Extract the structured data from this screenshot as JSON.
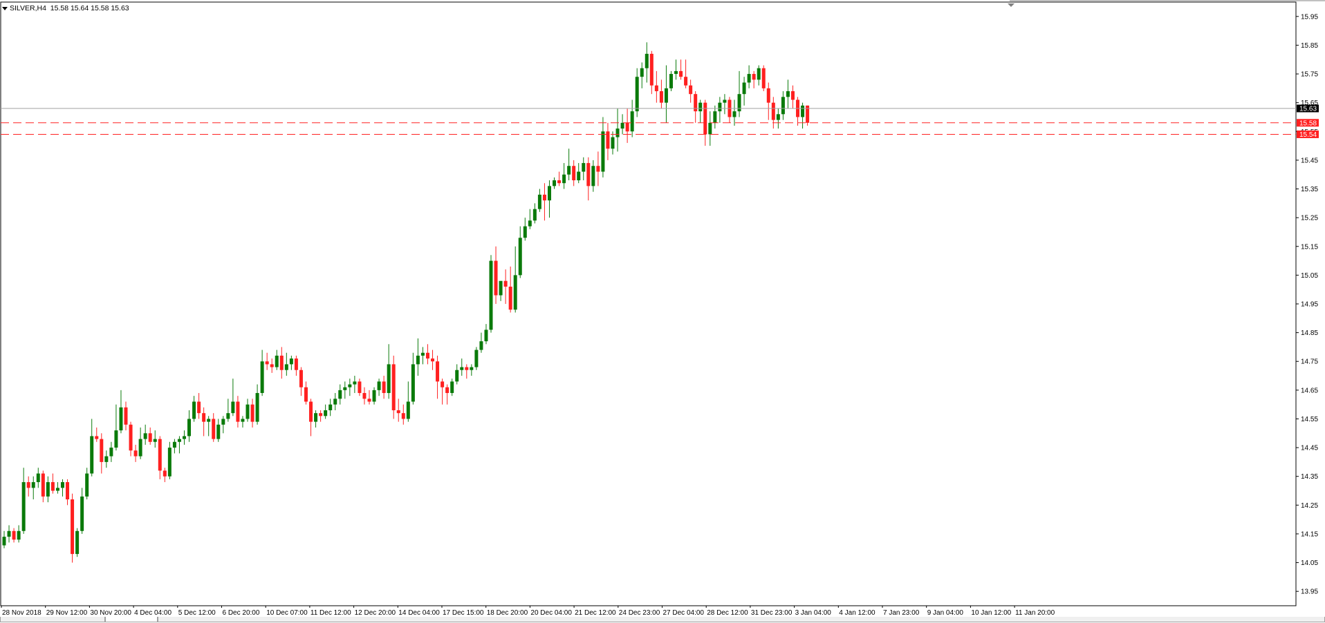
{
  "header": {
    "symbol_label": "SILVER,H4",
    "ohlc_text": "15.58 15.64 15.58 15.63"
  },
  "colors": {
    "bull": "#0a7a0a",
    "bear": "#ff2020",
    "bid_line": "#a0a0a0",
    "level_line": "#ff2020",
    "axis": "#000000",
    "background": "#ffffff"
  },
  "chart_data": {
    "type": "candlestick",
    "title": "SILVER,H4",
    "ylim": [
      13.9,
      16.0
    ],
    "y_ticks": [
      13.95,
      14.05,
      14.15,
      14.25,
      14.35,
      14.45,
      14.55,
      14.65,
      14.75,
      14.85,
      14.95,
      15.05,
      15.15,
      15.25,
      15.35,
      15.45,
      15.55,
      15.65,
      15.75,
      15.85,
      15.95
    ],
    "x_tick_labels": [
      "28 Nov 2018",
      "29 Nov 12:00",
      "30 Nov 20:00",
      "4 Dec 04:00",
      "5 Dec 12:00",
      "6 Dec 20:00",
      "10 Dec 07:00",
      "11 Dec 12:00",
      "12 Dec 20:00",
      "14 Dec 04:00",
      "17 Dec 15:00",
      "18 Dec 20:00",
      "20 Dec 04:00",
      "21 Dec 12:00",
      "24 Dec 23:00",
      "27 Dec 04:00",
      "28 Dec 12:00",
      "31 Dec 23:00",
      "3 Jan 04:00",
      "4 Jan 12:00",
      "7 Jan 23:00",
      "9 Jan 04:00",
      "10 Jan 12:00",
      "11 Jan 20:00"
    ],
    "current_price": 15.63,
    "current_price_label": "15.63",
    "horizontal_levels": [
      {
        "value": 15.58,
        "label": "15.58",
        "style": "dashed"
      },
      {
        "value": 15.54,
        "label": "15.54",
        "style": "dashed"
      }
    ],
    "candles": [
      [
        14.11,
        14.16,
        14.1,
        14.14
      ],
      [
        14.14,
        14.18,
        14.12,
        14.16
      ],
      [
        14.16,
        14.17,
        14.12,
        14.13
      ],
      [
        14.13,
        14.18,
        14.12,
        14.16
      ],
      [
        14.16,
        14.38,
        14.15,
        14.33
      ],
      [
        14.33,
        14.35,
        14.28,
        14.31
      ],
      [
        14.31,
        14.35,
        14.27,
        14.33
      ],
      [
        14.33,
        14.38,
        14.31,
        14.36
      ],
      [
        14.36,
        14.37,
        14.26,
        14.28
      ],
      [
        14.28,
        14.35,
        14.26,
        14.33
      ],
      [
        14.33,
        14.36,
        14.29,
        14.3
      ],
      [
        14.3,
        14.33,
        14.29,
        14.31
      ],
      [
        14.31,
        14.34,
        14.28,
        14.33
      ],
      [
        14.33,
        14.34,
        14.25,
        14.27
      ],
      [
        14.27,
        14.29,
        14.05,
        14.08
      ],
      [
        14.08,
        14.17,
        14.07,
        14.16
      ],
      [
        14.16,
        14.31,
        14.15,
        14.28
      ],
      [
        14.28,
        14.38,
        14.27,
        14.36
      ],
      [
        14.36,
        14.55,
        14.35,
        14.49
      ],
      [
        14.49,
        14.52,
        14.47,
        14.48
      ],
      [
        14.48,
        14.5,
        14.36,
        14.4
      ],
      [
        14.4,
        14.44,
        14.38,
        14.42
      ],
      [
        14.42,
        14.47,
        14.4,
        14.45
      ],
      [
        14.45,
        14.6,
        14.44,
        14.51
      ],
      [
        14.51,
        14.65,
        14.5,
        14.59
      ],
      [
        14.59,
        14.61,
        14.51,
        14.53
      ],
      [
        14.53,
        14.54,
        14.42,
        14.44
      ],
      [
        14.44,
        14.46,
        14.4,
        14.42
      ],
      [
        14.42,
        14.52,
        14.41,
        14.48
      ],
      [
        14.48,
        14.53,
        14.46,
        14.5
      ],
      [
        14.5,
        14.52,
        14.46,
        14.47
      ],
      [
        14.47,
        14.51,
        14.45,
        14.48
      ],
      [
        14.48,
        14.49,
        14.34,
        14.37
      ],
      [
        14.37,
        14.38,
        14.33,
        14.35
      ],
      [
        14.35,
        14.47,
        14.34,
        14.45
      ],
      [
        14.45,
        14.48,
        14.43,
        14.47
      ],
      [
        14.47,
        14.49,
        14.43,
        14.48
      ],
      [
        14.48,
        14.51,
        14.46,
        14.49
      ],
      [
        14.49,
        14.58,
        14.47,
        14.55
      ],
      [
        14.55,
        14.63,
        14.54,
        14.61
      ],
      [
        14.61,
        14.64,
        14.55,
        14.57
      ],
      [
        14.57,
        14.59,
        14.49,
        14.54
      ],
      [
        14.54,
        14.56,
        14.49,
        14.55
      ],
      [
        14.55,
        14.57,
        14.47,
        14.48
      ],
      [
        14.48,
        14.55,
        14.47,
        14.53
      ],
      [
        14.53,
        14.56,
        14.5,
        14.55
      ],
      [
        14.55,
        14.62,
        14.54,
        14.57
      ],
      [
        14.57,
        14.69,
        14.56,
        14.61
      ],
      [
        14.61,
        14.63,
        14.52,
        14.54
      ],
      [
        14.54,
        14.56,
        14.52,
        14.55
      ],
      [
        14.55,
        14.62,
        14.54,
        14.6
      ],
      [
        14.6,
        14.62,
        14.52,
        14.54
      ],
      [
        14.54,
        14.67,
        14.53,
        14.64
      ],
      [
        14.64,
        14.79,
        14.63,
        14.75
      ],
      [
        14.75,
        14.78,
        14.72,
        14.74
      ],
      [
        14.74,
        14.76,
        14.71,
        14.73
      ],
      [
        14.73,
        14.79,
        14.72,
        14.77
      ],
      [
        14.77,
        14.8,
        14.69,
        14.72
      ],
      [
        14.72,
        14.78,
        14.7,
        14.74
      ],
      [
        14.74,
        14.77,
        14.72,
        14.76
      ],
      [
        14.76,
        14.77,
        14.7,
        14.72
      ],
      [
        14.72,
        14.73,
        14.63,
        14.66
      ],
      [
        14.66,
        14.68,
        14.6,
        14.61
      ],
      [
        14.61,
        14.62,
        14.49,
        14.54
      ],
      [
        14.54,
        14.58,
        14.52,
        14.57
      ],
      [
        14.57,
        14.58,
        14.54,
        14.56
      ],
      [
        14.56,
        14.6,
        14.55,
        14.58
      ],
      [
        14.58,
        14.62,
        14.56,
        14.6
      ],
      [
        14.6,
        14.64,
        14.58,
        14.62
      ],
      [
        14.62,
        14.67,
        14.6,
        14.65
      ],
      [
        14.65,
        14.68,
        14.62,
        14.66
      ],
      [
        14.66,
        14.69,
        14.63,
        14.67
      ],
      [
        14.67,
        14.7,
        14.64,
        14.68
      ],
      [
        14.68,
        14.69,
        14.63,
        14.64
      ],
      [
        14.64,
        14.66,
        14.6,
        14.62
      ],
      [
        14.62,
        14.65,
        14.6,
        14.61
      ],
      [
        14.61,
        14.66,
        14.6,
        14.65
      ],
      [
        14.65,
        14.69,
        14.63,
        14.68
      ],
      [
        14.68,
        14.7,
        14.62,
        14.64
      ],
      [
        14.64,
        14.81,
        14.62,
        14.74
      ],
      [
        14.74,
        14.77,
        14.55,
        14.58
      ],
      [
        14.58,
        14.62,
        14.54,
        14.57
      ],
      [
        14.57,
        14.6,
        14.53,
        14.55
      ],
      [
        14.55,
        14.68,
        14.54,
        14.61
      ],
      [
        14.61,
        14.78,
        14.6,
        14.74
      ],
      [
        14.74,
        14.83,
        14.7,
        14.77
      ],
      [
        14.77,
        14.8,
        14.74,
        14.78
      ],
      [
        14.78,
        14.81,
        14.74,
        14.76
      ],
      [
        14.76,
        14.79,
        14.72,
        14.75
      ],
      [
        14.75,
        14.77,
        14.62,
        14.68
      ],
      [
        14.68,
        14.69,
        14.6,
        14.66
      ],
      [
        14.66,
        14.67,
        14.6,
        14.64
      ],
      [
        14.64,
        14.69,
        14.63,
        14.68
      ],
      [
        14.68,
        14.74,
        14.67,
        14.72
      ],
      [
        14.72,
        14.76,
        14.7,
        14.73
      ],
      [
        14.73,
        14.74,
        14.69,
        14.72
      ],
      [
        14.72,
        14.74,
        14.7,
        14.73
      ],
      [
        14.73,
        14.8,
        14.72,
        14.79
      ],
      [
        14.79,
        14.85,
        14.78,
        14.82
      ],
      [
        14.82,
        14.88,
        14.81,
        14.86
      ],
      [
        14.86,
        15.12,
        14.85,
        15.1
      ],
      [
        15.1,
        15.15,
        14.95,
        14.98
      ],
      [
        14.98,
        15.02,
        14.96,
        15.03
      ],
      [
        15.03,
        15.07,
        14.95,
        15.01
      ],
      [
        15.01,
        15.08,
        14.92,
        14.93
      ],
      [
        14.93,
        15.15,
        14.92,
        15.05
      ],
      [
        15.05,
        15.22,
        15.04,
        15.18
      ],
      [
        15.18,
        15.25,
        15.17,
        15.22
      ],
      [
        15.22,
        15.28,
        15.21,
        15.24
      ],
      [
        15.24,
        15.3,
        15.23,
        15.28
      ],
      [
        15.28,
        15.35,
        15.27,
        15.33
      ],
      [
        15.33,
        15.37,
        15.24,
        15.31
      ],
      [
        15.31,
        15.38,
        15.25,
        15.36
      ],
      [
        15.36,
        15.39,
        15.35,
        15.38
      ],
      [
        15.38,
        15.41,
        15.36,
        15.37
      ],
      [
        15.37,
        15.44,
        15.35,
        15.4
      ],
      [
        15.4,
        15.49,
        15.38,
        15.43
      ],
      [
        15.43,
        15.45,
        15.36,
        15.38
      ],
      [
        15.38,
        15.44,
        15.37,
        15.41
      ],
      [
        15.41,
        15.46,
        15.38,
        15.44
      ],
      [
        15.44,
        15.46,
        15.31,
        15.36
      ],
      [
        15.36,
        15.45,
        15.34,
        15.43
      ],
      [
        15.43,
        15.48,
        15.36,
        15.41
      ],
      [
        15.41,
        15.6,
        15.39,
        15.55
      ],
      [
        15.55,
        15.58,
        15.45,
        15.49
      ],
      [
        15.49,
        15.55,
        15.47,
        15.53
      ],
      [
        15.53,
        15.63,
        15.48,
        15.56
      ],
      [
        15.56,
        15.61,
        15.54,
        15.58
      ],
      [
        15.58,
        15.63,
        15.51,
        15.55
      ],
      [
        15.55,
        15.66,
        15.53,
        15.62
      ],
      [
        15.62,
        15.77,
        15.6,
        15.74
      ],
      [
        15.74,
        15.79,
        15.7,
        15.77
      ],
      [
        15.77,
        15.86,
        15.72,
        15.82
      ],
      [
        15.82,
        15.83,
        15.68,
        15.71
      ],
      [
        15.71,
        15.76,
        15.65,
        15.69
      ],
      [
        15.69,
        15.73,
        15.63,
        15.65
      ],
      [
        15.65,
        15.78,
        15.58,
        15.7
      ],
      [
        15.7,
        15.76,
        15.69,
        15.75
      ],
      [
        15.75,
        15.8,
        15.73,
        15.76
      ],
      [
        15.76,
        15.8,
        15.73,
        15.74
      ],
      [
        15.74,
        15.8,
        15.7,
        15.71
      ],
      [
        15.71,
        15.73,
        15.65,
        15.68
      ],
      [
        15.68,
        15.69,
        15.58,
        15.62
      ],
      [
        15.62,
        15.66,
        15.58,
        15.65
      ],
      [
        15.65,
        15.66,
        15.5,
        15.54
      ],
      [
        15.54,
        15.62,
        15.5,
        15.58
      ],
      [
        15.58,
        15.64,
        15.56,
        15.62
      ],
      [
        15.62,
        15.67,
        15.58,
        15.65
      ],
      [
        15.65,
        15.68,
        15.61,
        15.66
      ],
      [
        15.66,
        15.67,
        15.58,
        15.6
      ],
      [
        15.6,
        15.66,
        15.57,
        15.62
      ],
      [
        15.62,
        15.76,
        15.6,
        15.68
      ],
      [
        15.68,
        15.74,
        15.64,
        15.72
      ],
      [
        15.72,
        15.78,
        15.7,
        15.75
      ],
      [
        15.75,
        15.76,
        15.7,
        15.73
      ],
      [
        15.73,
        15.78,
        15.71,
        15.77
      ],
      [
        15.77,
        15.78,
        15.69,
        15.7
      ],
      [
        15.7,
        15.72,
        15.59,
        15.65
      ],
      [
        15.65,
        15.67,
        15.56,
        15.59
      ],
      [
        15.59,
        15.63,
        15.56,
        15.61
      ],
      [
        15.61,
        15.69,
        15.59,
        15.67
      ],
      [
        15.67,
        15.73,
        15.63,
        15.69
      ],
      [
        15.69,
        15.71,
        15.63,
        15.66
      ],
      [
        15.66,
        15.67,
        15.57,
        15.6
      ],
      [
        15.6,
        15.65,
        15.56,
        15.64
      ],
      [
        15.64,
        15.64,
        15.57,
        15.58
      ]
    ]
  }
}
